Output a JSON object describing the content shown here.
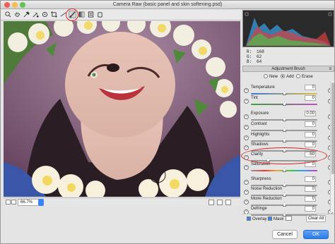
{
  "window": {
    "title": "Camera Raw (basic panel and skin softening.psd)"
  },
  "toolbar": {
    "tools": [
      "zoom-icon",
      "hand-icon",
      "white-balance-icon",
      "color-sampler-icon",
      "targeted-adjust-icon",
      "crop-icon",
      "straighten-icon",
      "adjustment-brush-icon",
      "graduated-filter-icon",
      "preferences-icon",
      "rotate-icon"
    ]
  },
  "readout": {
    "r_label": "R:",
    "r": "168",
    "g_label": "G:",
    "g": "62",
    "b_label": "B:",
    "b": "64"
  },
  "panel": {
    "title": "Adjustment Brush",
    "modes": {
      "new": "New",
      "add": "Add",
      "erase": "Erase"
    },
    "sliders": [
      {
        "label": "Temperature",
        "value": "0"
      },
      {
        "label": "Tint",
        "value": "0"
      },
      {
        "label": "Exposure",
        "value": "0.00"
      },
      {
        "label": "Contrast",
        "value": "0"
      },
      {
        "label": "Highlights",
        "value": "0"
      },
      {
        "label": "Shadows",
        "value": "0"
      },
      {
        "label": "Clarity",
        "value": "-50"
      },
      {
        "label": "Saturation",
        "value": "0"
      },
      {
        "label": "Sharpness",
        "value": "0"
      },
      {
        "label": "Noise Reduction",
        "value": "0"
      },
      {
        "label": "Moire Reduction",
        "value": "0"
      },
      {
        "label": "Defringe",
        "value": "0"
      }
    ],
    "overlay_label": "Overlay",
    "mask_label": "Mask",
    "clear_all": "Clear All"
  },
  "status": {
    "zoom": "66.7%"
  },
  "buttons": {
    "cancel": "Cancel",
    "ok": "OK"
  }
}
